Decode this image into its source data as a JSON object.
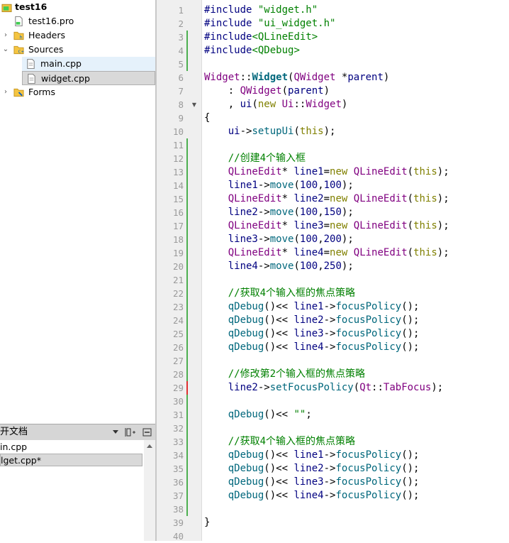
{
  "project_tree": {
    "items": [
      {
        "label": "test16",
        "icon": "qt-project-icon",
        "bold": true,
        "arrow": ""
      },
      {
        "label": "test16.pro",
        "icon": "pro-file-icon",
        "bold": false,
        "arrow": ""
      },
      {
        "label": "Headers",
        "icon": "headers-folder-icon",
        "bold": false,
        "arrow": "›"
      },
      {
        "label": "Sources",
        "icon": "sources-folder-icon",
        "bold": false,
        "arrow": "⌄"
      },
      {
        "label": "main.cpp",
        "icon": "cpp-file-icon",
        "bold": false,
        "arrow": ""
      },
      {
        "label": "widget.cpp",
        "icon": "cpp-file-icon",
        "bold": false,
        "arrow": ""
      },
      {
        "label": "Forms",
        "icon": "forms-folder-icon",
        "bold": false,
        "arrow": "›"
      }
    ]
  },
  "open_documents": {
    "title": "开文档",
    "items": [
      "in.cpp",
      "lget.cpp*"
    ]
  },
  "colors": {
    "gutter_bg": "#efefef",
    "modified_marker": "#4caf50",
    "unsaved_marker": "#e03030",
    "selection": "#e5f1fb"
  },
  "editor": {
    "lines": [
      {
        "n": "1",
        "tokens": [
          [
            "t-pre",
            "#include "
          ],
          [
            "t-str",
            "\"widget.h\""
          ]
        ]
      },
      {
        "n": "2",
        "tokens": [
          [
            "t-pre",
            "#include "
          ],
          [
            "t-str",
            "\"ui_widget.h\""
          ]
        ]
      },
      {
        "n": "3",
        "tokens": [
          [
            "t-pre",
            "#include"
          ],
          [
            "t-inc",
            "<QLineEdit>"
          ]
        ]
      },
      {
        "n": "4",
        "tokens": [
          [
            "t-pre",
            "#include"
          ],
          [
            "t-inc",
            "<QDebug>"
          ]
        ]
      },
      {
        "n": "5",
        "tokens": []
      },
      {
        "n": "6",
        "tokens": [
          [
            "t-type",
            "Widget"
          ],
          [
            "t-def",
            "::"
          ],
          [
            "t-ctor",
            "Widget"
          ],
          [
            "t-def",
            "("
          ],
          [
            "t-type",
            "QWidget"
          ],
          [
            "t-def",
            " *"
          ],
          [
            "t-var",
            "parent"
          ],
          [
            "t-def",
            ")"
          ]
        ]
      },
      {
        "n": "7",
        "tokens": [
          [
            "t-def",
            "    : "
          ],
          [
            "t-type",
            "QWidget"
          ],
          [
            "t-def",
            "("
          ],
          [
            "t-var",
            "parent"
          ],
          [
            "t-def",
            ")"
          ]
        ]
      },
      {
        "n": "8",
        "tokens": [
          [
            "t-def",
            "    , "
          ],
          [
            "t-var",
            "ui"
          ],
          [
            "t-def",
            "("
          ],
          [
            "t-kw",
            "new"
          ],
          [
            "t-def",
            " "
          ],
          [
            "t-type",
            "Ui"
          ],
          [
            "t-def",
            "::"
          ],
          [
            "t-type",
            "Widget"
          ],
          [
            "t-def",
            ")"
          ]
        ]
      },
      {
        "n": "9",
        "tokens": [
          [
            "t-def",
            "{"
          ]
        ]
      },
      {
        "n": "10",
        "tokens": [
          [
            "t-def",
            "    "
          ],
          [
            "t-var",
            "ui"
          ],
          [
            "t-def",
            "->"
          ],
          [
            "t-fn",
            "setupUi"
          ],
          [
            "t-def",
            "("
          ],
          [
            "t-kw",
            "this"
          ],
          [
            "t-def",
            ");"
          ]
        ]
      },
      {
        "n": "11",
        "tokens": []
      },
      {
        "n": "12",
        "tokens": [
          [
            "t-def",
            "    "
          ],
          [
            "t-com",
            "//创建4个输入框"
          ]
        ]
      },
      {
        "n": "13",
        "tokens": [
          [
            "t-def",
            "    "
          ],
          [
            "t-type",
            "QLineEdit"
          ],
          [
            "t-def",
            "* "
          ],
          [
            "t-var",
            "line1"
          ],
          [
            "t-def",
            "="
          ],
          [
            "t-kw",
            "new"
          ],
          [
            "t-def",
            " "
          ],
          [
            "t-type",
            "QLineEdit"
          ],
          [
            "t-def",
            "("
          ],
          [
            "t-kw",
            "this"
          ],
          [
            "t-def",
            ");"
          ]
        ]
      },
      {
        "n": "14",
        "tokens": [
          [
            "t-def",
            "    "
          ],
          [
            "t-var",
            "line1"
          ],
          [
            "t-def",
            "->"
          ],
          [
            "t-fn",
            "move"
          ],
          [
            "t-def",
            "("
          ],
          [
            "t-num",
            "100"
          ],
          [
            "t-def",
            ","
          ],
          [
            "t-num",
            "100"
          ],
          [
            "t-def",
            ");"
          ]
        ]
      },
      {
        "n": "15",
        "tokens": [
          [
            "t-def",
            "    "
          ],
          [
            "t-type",
            "QLineEdit"
          ],
          [
            "t-def",
            "* "
          ],
          [
            "t-var",
            "line2"
          ],
          [
            "t-def",
            "="
          ],
          [
            "t-kw",
            "new"
          ],
          [
            "t-def",
            " "
          ],
          [
            "t-type",
            "QLineEdit"
          ],
          [
            "t-def",
            "("
          ],
          [
            "t-kw",
            "this"
          ],
          [
            "t-def",
            ");"
          ]
        ]
      },
      {
        "n": "16",
        "tokens": [
          [
            "t-def",
            "    "
          ],
          [
            "t-var",
            "line2"
          ],
          [
            "t-def",
            "->"
          ],
          [
            "t-fn",
            "move"
          ],
          [
            "t-def",
            "("
          ],
          [
            "t-num",
            "100"
          ],
          [
            "t-def",
            ","
          ],
          [
            "t-num",
            "150"
          ],
          [
            "t-def",
            ");"
          ]
        ]
      },
      {
        "n": "17",
        "tokens": [
          [
            "t-def",
            "    "
          ],
          [
            "t-type",
            "QLineEdit"
          ],
          [
            "t-def",
            "* "
          ],
          [
            "t-var",
            "line3"
          ],
          [
            "t-def",
            "="
          ],
          [
            "t-kw",
            "new"
          ],
          [
            "t-def",
            " "
          ],
          [
            "t-type",
            "QLineEdit"
          ],
          [
            "t-def",
            "("
          ],
          [
            "t-kw",
            "this"
          ],
          [
            "t-def",
            ");"
          ]
        ]
      },
      {
        "n": "18",
        "tokens": [
          [
            "t-def",
            "    "
          ],
          [
            "t-var",
            "line3"
          ],
          [
            "t-def",
            "->"
          ],
          [
            "t-fn",
            "move"
          ],
          [
            "t-def",
            "("
          ],
          [
            "t-num",
            "100"
          ],
          [
            "t-def",
            ","
          ],
          [
            "t-num",
            "200"
          ],
          [
            "t-def",
            ");"
          ]
        ]
      },
      {
        "n": "19",
        "tokens": [
          [
            "t-def",
            "    "
          ],
          [
            "t-type",
            "QLineEdit"
          ],
          [
            "t-def",
            "* "
          ],
          [
            "t-var",
            "line4"
          ],
          [
            "t-def",
            "="
          ],
          [
            "t-kw",
            "new"
          ],
          [
            "t-def",
            " "
          ],
          [
            "t-type",
            "QLineEdit"
          ],
          [
            "t-def",
            "("
          ],
          [
            "t-kw",
            "this"
          ],
          [
            "t-def",
            ");"
          ]
        ]
      },
      {
        "n": "20",
        "tokens": [
          [
            "t-def",
            "    "
          ],
          [
            "t-var",
            "line4"
          ],
          [
            "t-def",
            "->"
          ],
          [
            "t-fn",
            "move"
          ],
          [
            "t-def",
            "("
          ],
          [
            "t-num",
            "100"
          ],
          [
            "t-def",
            ","
          ],
          [
            "t-num",
            "250"
          ],
          [
            "t-def",
            ");"
          ]
        ]
      },
      {
        "n": "21",
        "tokens": []
      },
      {
        "n": "22",
        "tokens": [
          [
            "t-def",
            "    "
          ],
          [
            "t-com",
            "//获取4个输入框的焦点策略"
          ]
        ]
      },
      {
        "n": "23",
        "tokens": [
          [
            "t-def",
            "    "
          ],
          [
            "t-fn",
            "qDebug"
          ],
          [
            "t-def",
            "()<< "
          ],
          [
            "t-var",
            "line1"
          ],
          [
            "t-def",
            "->"
          ],
          [
            "t-fn",
            "focusPolicy"
          ],
          [
            "t-def",
            "();"
          ]
        ]
      },
      {
        "n": "24",
        "tokens": [
          [
            "t-def",
            "    "
          ],
          [
            "t-fn",
            "qDebug"
          ],
          [
            "t-def",
            "()<< "
          ],
          [
            "t-var",
            "line2"
          ],
          [
            "t-def",
            "->"
          ],
          [
            "t-fn",
            "focusPolicy"
          ],
          [
            "t-def",
            "();"
          ]
        ]
      },
      {
        "n": "25",
        "tokens": [
          [
            "t-def",
            "    "
          ],
          [
            "t-fn",
            "qDebug"
          ],
          [
            "t-def",
            "()<< "
          ],
          [
            "t-var",
            "line3"
          ],
          [
            "t-def",
            "->"
          ],
          [
            "t-fn",
            "focusPolicy"
          ],
          [
            "t-def",
            "();"
          ]
        ]
      },
      {
        "n": "26",
        "tokens": [
          [
            "t-def",
            "    "
          ],
          [
            "t-fn",
            "qDebug"
          ],
          [
            "t-def",
            "()<< "
          ],
          [
            "t-var",
            "line4"
          ],
          [
            "t-def",
            "->"
          ],
          [
            "t-fn",
            "focusPolicy"
          ],
          [
            "t-def",
            "();"
          ]
        ]
      },
      {
        "n": "27",
        "tokens": []
      },
      {
        "n": "28",
        "tokens": [
          [
            "t-def",
            "    "
          ],
          [
            "t-com",
            "//修改第2个输入框的焦点策略"
          ]
        ]
      },
      {
        "n": "29",
        "tokens": [
          [
            "t-def",
            "    "
          ],
          [
            "t-var",
            "line2"
          ],
          [
            "t-def",
            "->"
          ],
          [
            "t-fn",
            "setFocusPolicy"
          ],
          [
            "t-def",
            "("
          ],
          [
            "t-type",
            "Qt"
          ],
          [
            "t-def",
            "::"
          ],
          [
            "t-type",
            "TabFocus"
          ],
          [
            "t-def",
            ");"
          ]
        ]
      },
      {
        "n": "30",
        "tokens": []
      },
      {
        "n": "31",
        "tokens": [
          [
            "t-def",
            "    "
          ],
          [
            "t-fn",
            "qDebug"
          ],
          [
            "t-def",
            "()<< "
          ],
          [
            "t-str",
            "\"\""
          ],
          [
            "t-def",
            ";"
          ]
        ]
      },
      {
        "n": "32",
        "tokens": []
      },
      {
        "n": "33",
        "tokens": [
          [
            "t-def",
            "    "
          ],
          [
            "t-com",
            "//获取4个输入框的焦点策略"
          ]
        ]
      },
      {
        "n": "34",
        "tokens": [
          [
            "t-def",
            "    "
          ],
          [
            "t-fn",
            "qDebug"
          ],
          [
            "t-def",
            "()<< "
          ],
          [
            "t-var",
            "line1"
          ],
          [
            "t-def",
            "->"
          ],
          [
            "t-fn",
            "focusPolicy"
          ],
          [
            "t-def",
            "();"
          ]
        ]
      },
      {
        "n": "35",
        "tokens": [
          [
            "t-def",
            "    "
          ],
          [
            "t-fn",
            "qDebug"
          ],
          [
            "t-def",
            "()<< "
          ],
          [
            "t-var",
            "line2"
          ],
          [
            "t-def",
            "->"
          ],
          [
            "t-fn",
            "focusPolicy"
          ],
          [
            "t-def",
            "();"
          ]
        ]
      },
      {
        "n": "36",
        "tokens": [
          [
            "t-def",
            "    "
          ],
          [
            "t-fn",
            "qDebug"
          ],
          [
            "t-def",
            "()<< "
          ],
          [
            "t-var",
            "line3"
          ],
          [
            "t-def",
            "->"
          ],
          [
            "t-fn",
            "focusPolicy"
          ],
          [
            "t-def",
            "();"
          ]
        ]
      },
      {
        "n": "37",
        "tokens": [
          [
            "t-def",
            "    "
          ],
          [
            "t-fn",
            "qDebug"
          ],
          [
            "t-def",
            "()<< "
          ],
          [
            "t-var",
            "line4"
          ],
          [
            "t-def",
            "->"
          ],
          [
            "t-fn",
            "focusPolicy"
          ],
          [
            "t-def",
            "();"
          ]
        ]
      },
      {
        "n": "38",
        "tokens": []
      },
      {
        "n": "39",
        "tokens": [
          [
            "t-def",
            "}"
          ]
        ]
      },
      {
        "n": "40",
        "tokens": []
      }
    ],
    "modified_lines": [
      "3",
      "4",
      "5",
      "11",
      "12",
      "13",
      "14",
      "15",
      "16",
      "17",
      "18",
      "19",
      "20",
      "21",
      "22",
      "23",
      "24",
      "25",
      "26",
      "27",
      "28",
      "30",
      "31",
      "32",
      "33",
      "34",
      "35",
      "36",
      "37",
      "38"
    ],
    "unsaved_lines": [
      "29"
    ],
    "fold_lines": [
      "8"
    ]
  }
}
